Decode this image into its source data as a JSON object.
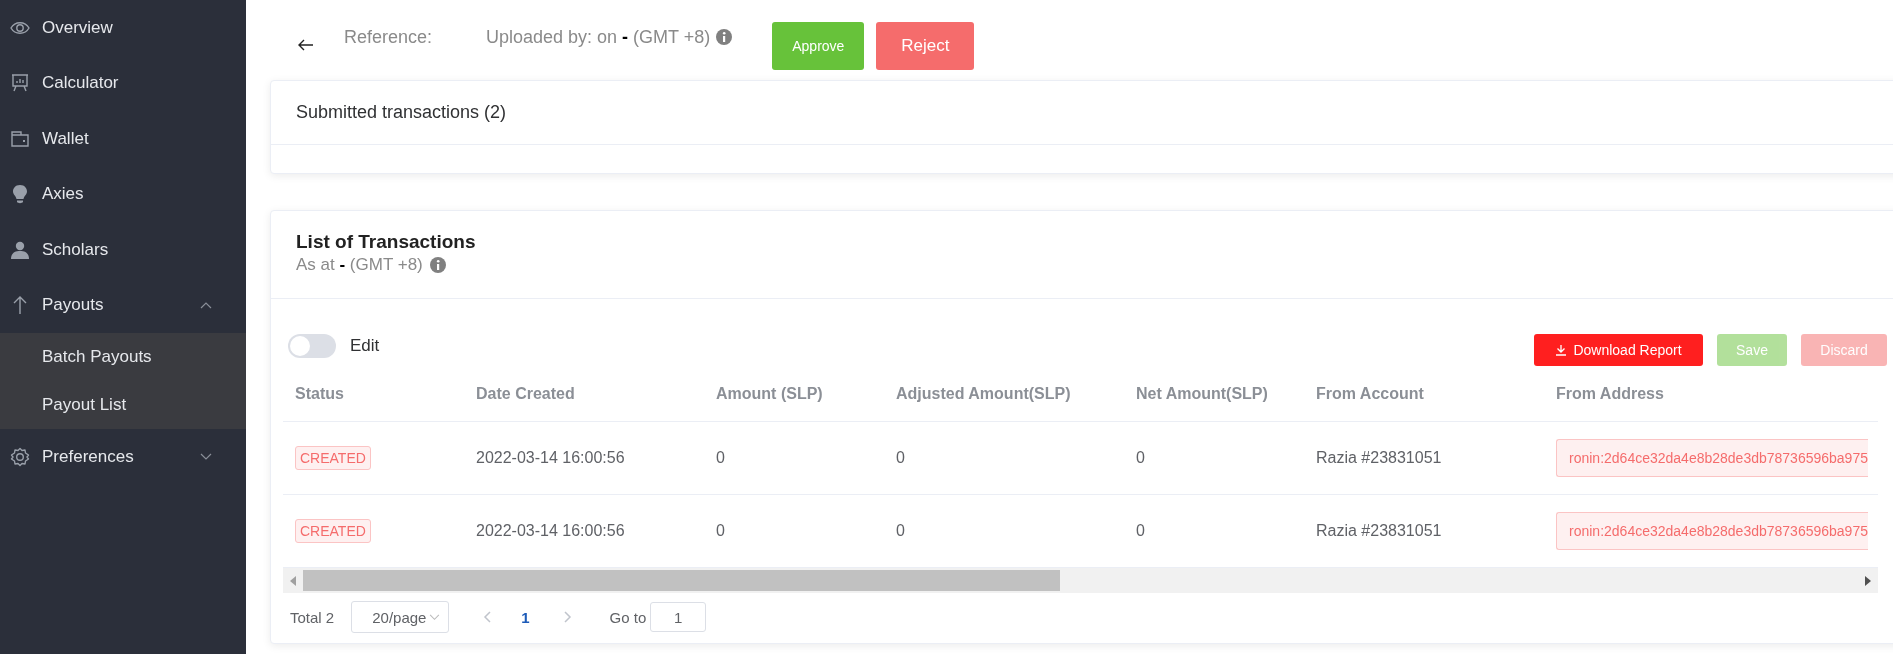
{
  "sidebar": {
    "items": [
      {
        "label": "Overview"
      },
      {
        "label": "Calculator"
      },
      {
        "label": "Wallet"
      },
      {
        "label": "Axies"
      },
      {
        "label": "Scholars"
      },
      {
        "label": "Payouts",
        "expanded": true,
        "children": [
          {
            "label": "Batch Payouts"
          },
          {
            "label": "Payout List"
          }
        ]
      },
      {
        "label": "Preferences",
        "expanded": false
      }
    ]
  },
  "header": {
    "reference": "Reference:",
    "uploaded": "Uploaded by: on **-** (GMT +8)",
    "buttons": [
      {
        "label": "Approve",
        "kind": "approve"
      },
      {
        "label": "Reject",
        "kind": "reject"
      }
    ]
  },
  "submitted": {
    "title": "Submitted transactions (2)"
  },
  "transactions": {
    "title": "List of Transactions",
    "subtitle": "As at **-** (GMT +8)",
    "edit_toggle": {
      "label": "Edit",
      "on": false
    },
    "buttons": [
      {
        "label": "Download Report",
        "kind": "download",
        "disabled": false
      },
      {
        "label": "Save",
        "kind": "save",
        "disabled": true
      },
      {
        "label": "Discard",
        "kind": "discard",
        "disabled": true
      }
    ],
    "columns": [
      "Status",
      "Date Created",
      "Amount (SLP)",
      "Adjusted Amount(SLP)",
      "Net Amount(SLP)",
      "From Account",
      "From Address"
    ],
    "rows": [
      {
        "status": "CREATED",
        "date": "2022-03-14 16:00:56",
        "amount": "0",
        "adjusted": "0",
        "net": "0",
        "account": "Razia #23831051",
        "address": "ronin:2d64ce32da4e8b28de3db78736596ba975"
      },
      {
        "status": "CREATED",
        "date": "2022-03-14 16:00:56",
        "amount": "0",
        "adjusted": "0",
        "net": "0",
        "account": "Razia #23831051",
        "address": "ronin:2d64ce32da4e8b28de3db78736596ba975"
      }
    ],
    "pagination": {
      "total": "Total 2",
      "page_size": "20/page",
      "pages": [
        {
          "label": "1",
          "selected": true
        }
      ],
      "goto_label": "Go to",
      "goto_value": "1"
    }
  }
}
